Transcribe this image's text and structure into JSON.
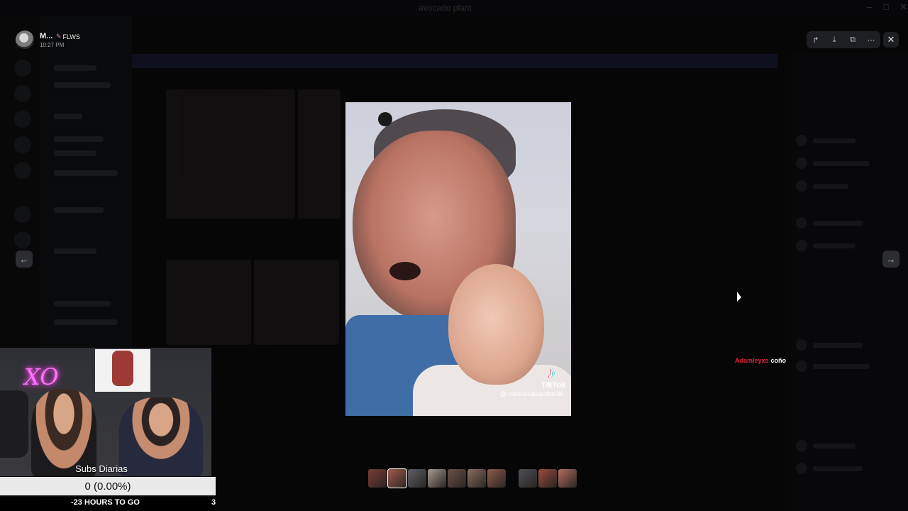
{
  "window": {
    "title": "avocado plant",
    "controls": [
      "–",
      "□",
      "✕"
    ]
  },
  "viewer": {
    "author": "M...",
    "badge": "FLWS",
    "timestamp": "10:27 PM",
    "actions": [
      {
        "name": "forward-icon",
        "glyph": "↱"
      },
      {
        "name": "download-icon",
        "glyph": "⤓"
      },
      {
        "name": "open-external-icon",
        "glyph": "⧉"
      },
      {
        "name": "more-icon",
        "glyph": "⋯"
      }
    ],
    "close_glyph": "✕",
    "prev_glyph": "←",
    "next_glyph": "→"
  },
  "media": {
    "watermark_brand": "TikTok",
    "watermark_logo": "♪",
    "watermark_handle": "@ memenubrandon36"
  },
  "chat": {
    "user": "Adamleyxs",
    "message": "coño"
  },
  "filmstrip": {
    "colors": [
      "#7a3b35",
      "#a25d4e",
      "#5b5f66",
      "#a89a93",
      "#6b5148",
      "#8a6f63",
      "#8c5b4e",
      "gap",
      "#4e4f56",
      "#9a4a40",
      "#b46d5f"
    ],
    "active_index": 1
  },
  "stream_overlay": {
    "neon_sign": "XO",
    "subs_title": "Subs Diarias",
    "subs_progress": "0 (0.00%)",
    "hours_left": "-23 HOURS TO GO",
    "goal_count": "3"
  },
  "colors": {
    "accent_red": "#e0243a",
    "neon_pink": "#ff71ff",
    "panel": "#1e1f22"
  }
}
